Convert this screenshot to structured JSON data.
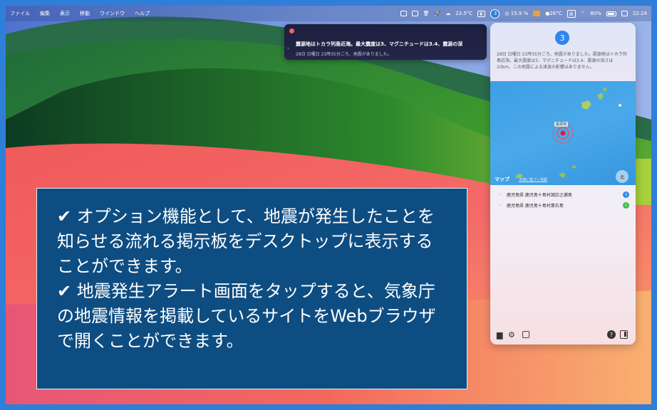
{
  "menubar": {
    "items": [
      "ファイル",
      "編集",
      "表示",
      "移動",
      "ウインドウ",
      "ヘルプ"
    ],
    "status": {
      "weather_temp": "23.5°C",
      "quake_count": "3",
      "cpu": "15.9 %",
      "temp2": "26°C",
      "input_mode": "あ",
      "battery": "80%",
      "time": "22:24"
    },
    "icons": [
      "display-icon",
      "monitor-icon",
      "trash-icon",
      "rocket-icon",
      "cloud-icon",
      "mask-icon",
      "quake-badge-icon",
      "cpu-icon",
      "orange-app-icon",
      "sun-icon",
      "wifi-icon",
      "battery-icon",
      "control-center-icon"
    ]
  },
  "notification": {
    "title": "震源地はトカラ列島近海。最大震度は3、マグニチュードは3.4、震源の深",
    "subtitle": "28日 日曜日 21時35分ごろ、地震がありました。"
  },
  "panel": {
    "count": "3",
    "description": "28日 日曜日 21時35分ごろ、地震がありました。震源地はトカラ列島近海。最大震度は3、マグニチュードは3.4、震源の深さは10km、この地震による津波の影響はありません。",
    "map": {
      "epicenter_label": "震源地",
      "brand": "マップ",
      "legal": "法律に基づく情報",
      "compass": "北"
    },
    "list": [
      {
        "label": "鹿児島県 鹿児島十島村諏訪之瀬島",
        "intensity": "3",
        "color": "#2f86ee"
      },
      {
        "label": "鹿児島県 鹿児島十島村悪石島",
        "intensity": "1",
        "color": "#3cbf4a"
      }
    ],
    "footer": {
      "help": "?"
    }
  },
  "caption": {
    "line1": "✔ オプション機能として、地震が発生したことを知らせる流れる掲示板をデスクトップに表示することができます。",
    "line2": "✔ 地震発生アラート画面をタップすると、気象庁の地震情報を掲載しているサイトをWebブラウザで開くことができます。"
  }
}
